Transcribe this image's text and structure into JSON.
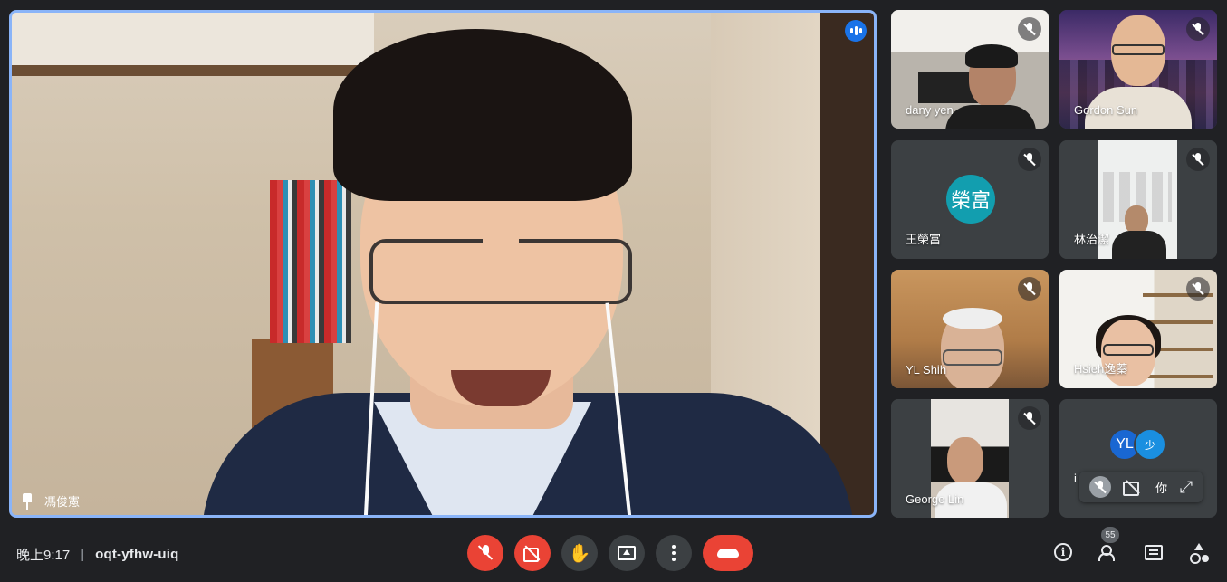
{
  "main_speaker": {
    "name": "馮俊憲"
  },
  "participants": [
    {
      "name": "dany yen",
      "muted": true
    },
    {
      "name": "Gordon Sun",
      "muted": true
    },
    {
      "name": "王榮富",
      "avatar_text": "榮富",
      "avatar_color": "#129eaf",
      "muted": true
    },
    {
      "name": "林治潔",
      "muted": true
    },
    {
      "name": "YL Shih",
      "muted": true
    },
    {
      "name": "Hsieh逸蓁",
      "muted": true
    },
    {
      "name": "George Lin",
      "muted": true
    }
  ],
  "others_tile": {
    "avatars": [
      "YL",
      "少"
    ],
    "label_fragment": "i",
    "hover_text": "你"
  },
  "meeting": {
    "time": "晚上9:17",
    "separator": "|",
    "code": "oqt-yfhw-uiq"
  },
  "people_count": "55",
  "colors": {
    "background": "#202124",
    "active_border": "#8ab4f8",
    "danger": "#ea4335",
    "control_bg": "#3c4043"
  },
  "icons": {
    "speaking": "audio-level-icon",
    "pin": "pin-icon",
    "mic_off": "mic-off-icon",
    "cam_off": "camera-off-icon",
    "hand": "raise-hand-icon",
    "present": "present-screen-icon",
    "more": "more-options-icon",
    "leave": "hang-up-icon",
    "info": "info-icon",
    "people": "people-icon",
    "chat": "chat-icon",
    "activities": "activities-icon"
  }
}
